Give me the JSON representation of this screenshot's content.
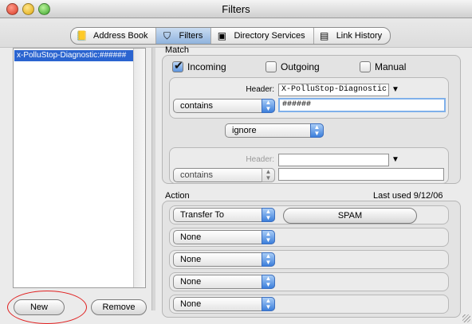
{
  "window": {
    "title": "Filters"
  },
  "tabs": [
    {
      "label": "Address Book",
      "icon": "address-book-icon"
    },
    {
      "label": "Filters",
      "icon": "filters-icon",
      "active": true
    },
    {
      "label": "Directory Services",
      "icon": "directory-services-icon"
    },
    {
      "label": "Link History",
      "icon": "link-history-icon"
    }
  ],
  "filter_list": {
    "items": [
      "x-PolluStop-Diagnostic:######"
    ],
    "selected": 0
  },
  "buttons": {
    "new": "New",
    "remove": "Remove"
  },
  "match": {
    "title": "Match",
    "incoming": {
      "label": "Incoming",
      "checked": true
    },
    "outgoing": {
      "label": "Outgoing",
      "checked": false
    },
    "manual": {
      "label": "Manual",
      "checked": false
    },
    "criterion1": {
      "header_label": "Header:",
      "header_value": "X-PolluStop-Diagnostic",
      "operator": "contains",
      "value": "######"
    },
    "conjunction": "ignore",
    "criterion2": {
      "header_label": "Header:",
      "header_value": "",
      "operator": "contains",
      "value": ""
    }
  },
  "action": {
    "title": "Action",
    "last_used": "Last used 9/12/06",
    "rows": [
      {
        "action": "Transfer To",
        "target": "SPAM"
      },
      {
        "action": "None"
      },
      {
        "action": "None"
      },
      {
        "action": "None"
      },
      {
        "action": "None"
      }
    ]
  },
  "colors": {
    "selection": "#2a64d0",
    "accent": "#3c7fdb",
    "annotation": "#e02020"
  }
}
